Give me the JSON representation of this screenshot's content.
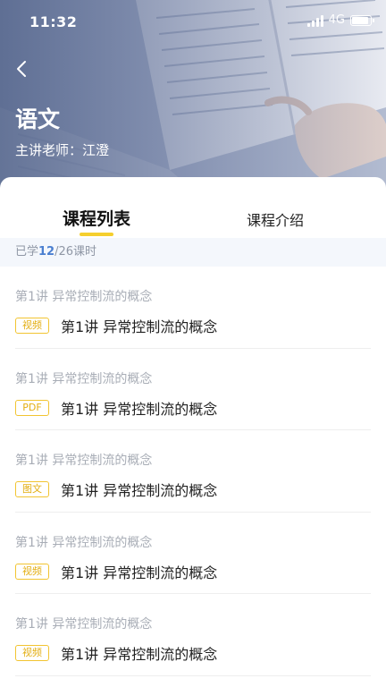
{
  "status": {
    "time": "11:32",
    "network": "4G",
    "battery_level": 0.8
  },
  "header": {
    "title": "语文",
    "teacher": "主讲老师：江澄"
  },
  "tabs": [
    {
      "label": "课程列表",
      "active": true
    },
    {
      "label": "课程介绍",
      "active": false
    }
  ],
  "progress": {
    "prefix": "已学",
    "learned": "12",
    "total": "/26课时"
  },
  "lessons": [
    {
      "section": "第1讲 异常控制流的概念",
      "type": "视频",
      "title": "第1讲 异常控制流的概念"
    },
    {
      "section": "第1讲 异常控制流的概念",
      "type": "PDF",
      "title": "第1讲 异常控制流的概念"
    },
    {
      "section": "第1讲 异常控制流的概念",
      "type": "图文",
      "title": "第1讲 异常控制流的概念"
    },
    {
      "section": "第1讲 异常控制流的概念",
      "type": "视频",
      "title": "第1讲 异常控制流的概念"
    },
    {
      "section": "第1讲 异常控制流的概念",
      "type": "视频",
      "title": "第1讲 异常控制流的概念"
    }
  ],
  "colors": {
    "accent_yellow": "#f5cf2e",
    "badge_text": "#e3ae12",
    "progress_highlight": "#4a7fd0"
  },
  "icons": {
    "back": "chevron-left-icon",
    "signal": "signal-icon",
    "battery": "battery-icon"
  }
}
